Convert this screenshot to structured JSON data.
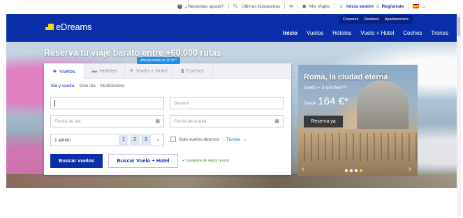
{
  "topbar": {
    "help": "¿Necesitas ayuda?",
    "recent": "Últimas búsquedas",
    "trips": "Mis Viajes",
    "login": "Inicia sesión",
    "or": "o",
    "register": "Regístrate",
    "help_icon": "question-icon",
    "search_icon": "magnifier-icon",
    "trips_icon": "suitcase-icon",
    "user_icon": "user-icon"
  },
  "brand": {
    "name": "eDreams"
  },
  "subnav": [
    "Cruceros",
    "Destinos",
    "Apartamentos"
  ],
  "mainnav": [
    "Inicio",
    "Vuelos",
    "Hoteles",
    "Vuelo + Hotel",
    "Coches",
    "Trenes"
  ],
  "hero": {
    "title": "Reserva tu viaje barato entre +60.000 rutas"
  },
  "search": {
    "promo_badge": "Ahorra hasta un 20 %**",
    "tabs": [
      "Vuelos",
      "Hoteles",
      "Vuelo + Hotel",
      "Coches"
    ],
    "trip_types": [
      "Ida y vuelta",
      "Solo ida",
      "Multidestino"
    ],
    "origin_placeholder": "",
    "destination_placeholder": "Destino",
    "departure_placeholder": "Fecha de ida",
    "return_placeholder": "Fecha de vuelta",
    "passengers": "1 adulto",
    "passenger_numbers": [
      "1",
      "2",
      "3"
    ],
    "direct_only": "Solo vuelos directos",
    "class": "Turista",
    "search_flights": "Buscar vuelos",
    "search_flight_hotel": "Buscar Vuelo + Hotel",
    "guarantee": "Garantía de mejor precio"
  },
  "promo_card": {
    "title": "Roma, la ciudad eterna",
    "subtitle": "Vuelo + 3 noches***",
    "from": "Desde",
    "price": "164 €*",
    "button": "Reserva ya",
    "slides": 4,
    "active_slide": 4
  },
  "colors": {
    "brand_blue": "#0a2ea8",
    "accent_yellow": "#ffd400",
    "success_green": "#2d8c3c"
  }
}
